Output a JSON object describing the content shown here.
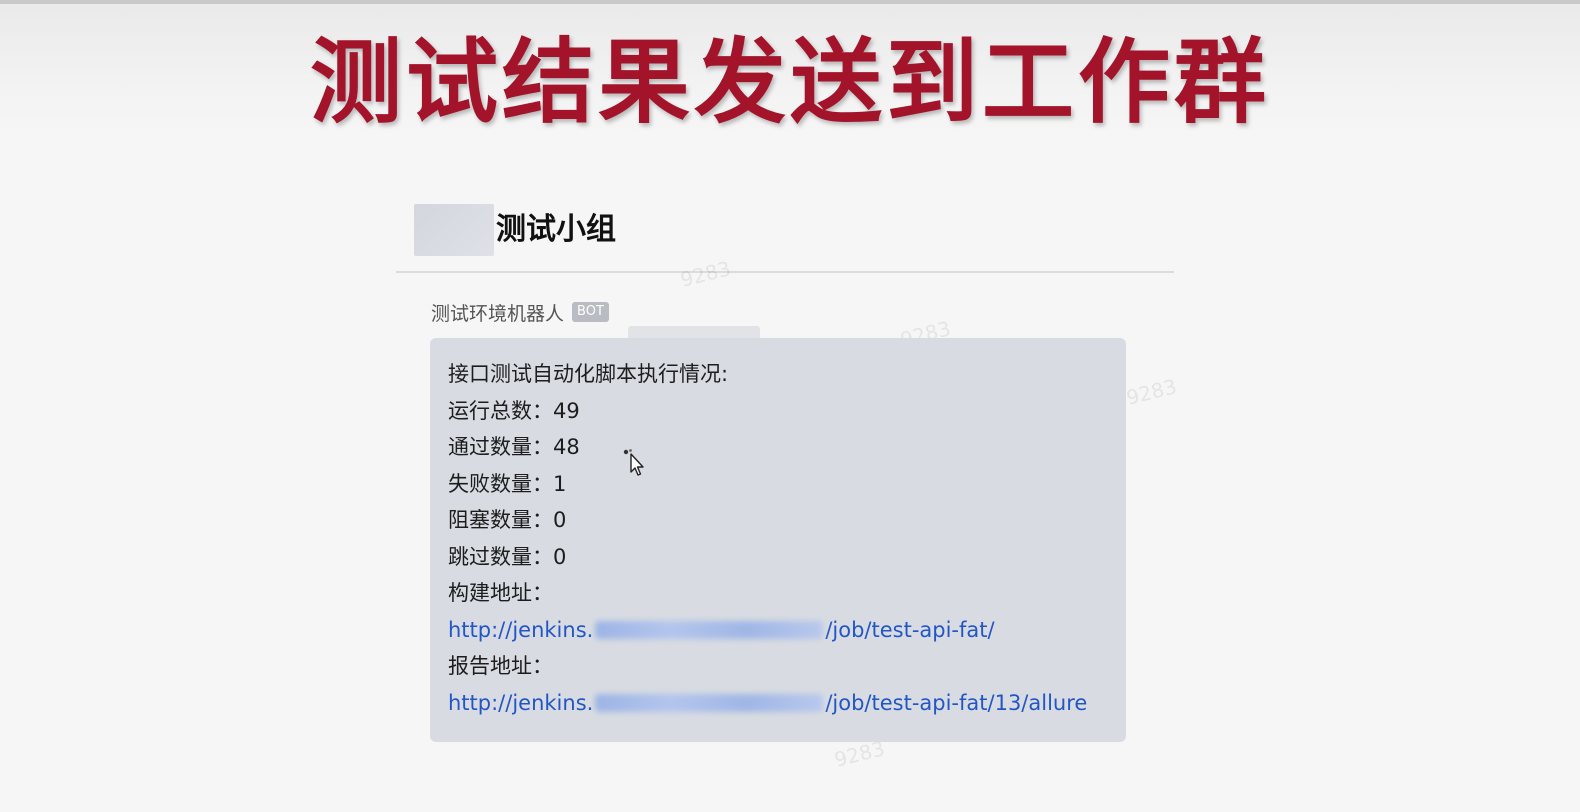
{
  "headline": "测试结果发送到工作群",
  "group": {
    "name": "测试小组"
  },
  "message": {
    "sender": "测试环境机器人",
    "badge": "BOT",
    "title": "接口测试自动化脚本执行情况:",
    "stats": [
      {
        "label": "运行总数：",
        "value": "49"
      },
      {
        "label": "通过数量：",
        "value": "48"
      },
      {
        "label": "失败数量：",
        "value": "1"
      },
      {
        "label": "阻塞数量：",
        "value": "0"
      },
      {
        "label": "跳过数量：",
        "value": "0"
      }
    ],
    "build_label": "构建地址：",
    "build_link": {
      "prefix": "http://jenkins.",
      "suffix": "/job/test-api-fat/"
    },
    "report_label": "报告地址：",
    "report_link": {
      "prefix": "http://jenkins.",
      "suffix": "/job/test-api-fat/13/allure"
    }
  },
  "watermark_text": "9283",
  "icons": {
    "cursor": "mouse-pointer-icon",
    "avatar": "group-avatar"
  }
}
